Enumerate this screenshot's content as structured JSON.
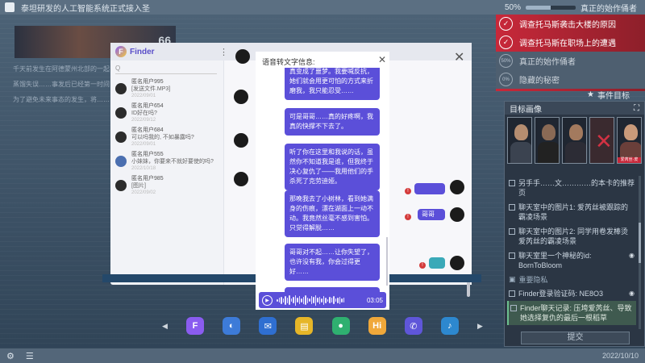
{
  "topbar": {
    "news_title": "泰坦研发的人工智能系统正式接入圣",
    "progress_text": "50%",
    "progress_value": 0.5,
    "goal_text": "真正的始作俑者"
  },
  "article": {
    "paragraphs": [
      "千天前发生在阿德蒙州北部的一起……",
      "蒸馏失误……事发后已经第一时间……",
      "为了避免未来事态的发生，将……"
    ]
  },
  "missions": [
    {
      "label": "调查托马斯袭击大楼的原因",
      "status": "done",
      "badge": "✓"
    },
    {
      "label": "调查托马斯在职场上的遭遇",
      "status": "done",
      "badge": "✓"
    },
    {
      "label": "真正的始作俑者",
      "status": "todo",
      "badge": "50%"
    },
    {
      "label": "隐藏的秘密",
      "status": "todo",
      "badge": "0%"
    }
  ],
  "events": {
    "header": "事件目标",
    "panel_title": "目标画像",
    "portrait_tag": "爱芮丝·皮",
    "items": [
      {
        "text": "另手手……文…………的本卡的推荐页",
        "selected": false
      },
      {
        "text": "聊天室中的图片1: 爱芮丝被跟踪的霸凌场景",
        "selected": false
      },
      {
        "text": "聊天室中的图片2: 同学用卷发棒烫爱芮丝的霸凌场景",
        "selected": false
      },
      {
        "text": "聊天室里一个神秘的id: BornToBloom",
        "selected": false
      },
      {
        "text": "Finder登录验证码: NE8O3",
        "selected": false
      },
      {
        "text": "Finder聊天记录: 压垮爱芮丝、导致她选择复仇的最后一根稻草",
        "selected": true
      }
    ],
    "section_label": "重要隐私",
    "submit_label": "提交"
  },
  "finder": {
    "title": "Finder",
    "menu_icon": "⋮",
    "search_placeholder": "Q",
    "contacts": [
      {
        "name": "匿名用户995",
        "message": "[发送文件.MP3]",
        "time": "2022/09/01"
      },
      {
        "name": "匿名用户654",
        "message": "ID好在吗?",
        "time": "2022/09/12"
      },
      {
        "name": "匿名用户684",
        "message": "可以吗我的, 不如暴露吗?",
        "time": "2022/09/01"
      },
      {
        "name": "匿名用户555",
        "message": "小妹妹，你要来不就好要使的吗?",
        "time": "2022/10/18"
      },
      {
        "name": "匿名用户985",
        "message": "[图片]",
        "time": "2022/09/02"
      }
    ],
    "side_bubble_1": "",
    "side_bubble_2": "哥哥"
  },
  "voice_modal": {
    "title": "语音转文字信息:",
    "close": "✕",
    "messages": [
      "真变成了噩梦。我要喊反抗，她们就会用更可怕的方式来折磨我，我只能忍受……",
      "可是哥哥……真的好疼啊，我真的快撑不下去了。",
      "听了你在这里和我说的话，虽然你不知道我是谁，但我终于决心复仇了——我用他们的手杀死了克劳迪娅。",
      "那晚我去了小树林，看到她满身的伤痕，漂在湖面上一动不动。我竟然丝毫不感到害怕。只觉得解脱……",
      "哥哥对不起……让你失望了，也许没有我，你会过得更好……",
      "……"
    ],
    "duration": "03:05"
  },
  "dock": {
    "apps": [
      {
        "name": "finder-app-icon",
        "glyph": "F",
        "color": "#8a5cf0"
      },
      {
        "name": "globe-app-icon",
        "glyph": "◐",
        "color": "#3d7bd8"
      },
      {
        "name": "mail-app-icon",
        "glyph": "✉",
        "color": "#2f6fd1"
      },
      {
        "name": "notes-app-icon",
        "glyph": "▤",
        "color": "#e6b628"
      },
      {
        "name": "location-app-icon",
        "glyph": "●",
        "color": "#2fb070"
      },
      {
        "name": "hi-app-icon",
        "glyph": "Hi",
        "color": "#f0a83a"
      },
      {
        "name": "phone-app-icon",
        "glyph": "✆",
        "color": "#5f56d9"
      },
      {
        "name": "music-app-icon",
        "glyph": "♪",
        "color": "#2d88cf"
      }
    ]
  },
  "bottombar": {
    "date": "2022/10/10"
  }
}
